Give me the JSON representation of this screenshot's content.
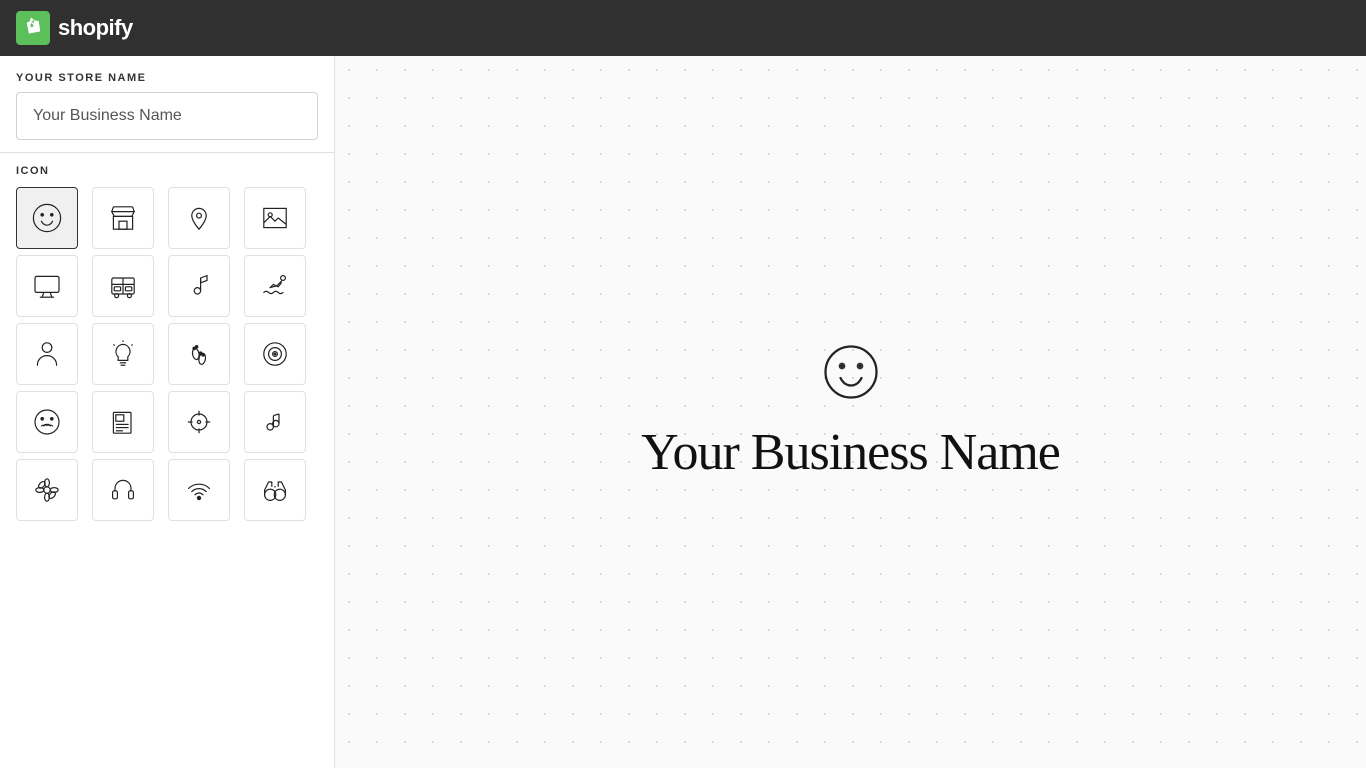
{
  "header": {
    "logo_text": "shopify",
    "logo_alt": "Shopify"
  },
  "sidebar": {
    "store_name_label": "YOUR STORE NAME",
    "store_name_placeholder": "Your Business Name",
    "store_name_value": "Your Business Name",
    "icon_label": "ICON"
  },
  "icons": [
    {
      "id": "smiley",
      "symbol": "smiley",
      "selected": true
    },
    {
      "id": "storefront",
      "symbol": "storefront",
      "selected": false
    },
    {
      "id": "location-pin",
      "symbol": "location-pin",
      "selected": false
    },
    {
      "id": "image-frame",
      "symbol": "image-frame",
      "selected": false
    },
    {
      "id": "monitor",
      "symbol": "monitor",
      "selected": false
    },
    {
      "id": "bus",
      "symbol": "bus",
      "selected": false
    },
    {
      "id": "music-note",
      "symbol": "music-note",
      "selected": false
    },
    {
      "id": "swimmer",
      "symbol": "swimmer",
      "selected": false
    },
    {
      "id": "person",
      "symbol": "person",
      "selected": false
    },
    {
      "id": "lightbulb",
      "symbol": "lightbulb",
      "selected": false
    },
    {
      "id": "footprints",
      "symbol": "footprints",
      "selected": false
    },
    {
      "id": "spiral",
      "symbol": "spiral",
      "selected": false
    },
    {
      "id": "mustache-face",
      "symbol": "mustache-face",
      "selected": false
    },
    {
      "id": "newspaper",
      "symbol": "newspaper",
      "selected": false
    },
    {
      "id": "crosshair",
      "symbol": "crosshair",
      "selected": false
    },
    {
      "id": "music-notes",
      "symbol": "music-notes",
      "selected": false
    },
    {
      "id": "flower",
      "symbol": "flower",
      "selected": false
    },
    {
      "id": "headphones",
      "symbol": "headphones",
      "selected": false
    },
    {
      "id": "wifi",
      "symbol": "wifi",
      "selected": false
    },
    {
      "id": "binoculars",
      "symbol": "binoculars",
      "selected": false
    }
  ],
  "preview": {
    "business_name": "Your Business Name",
    "selected_icon": "smiley"
  }
}
